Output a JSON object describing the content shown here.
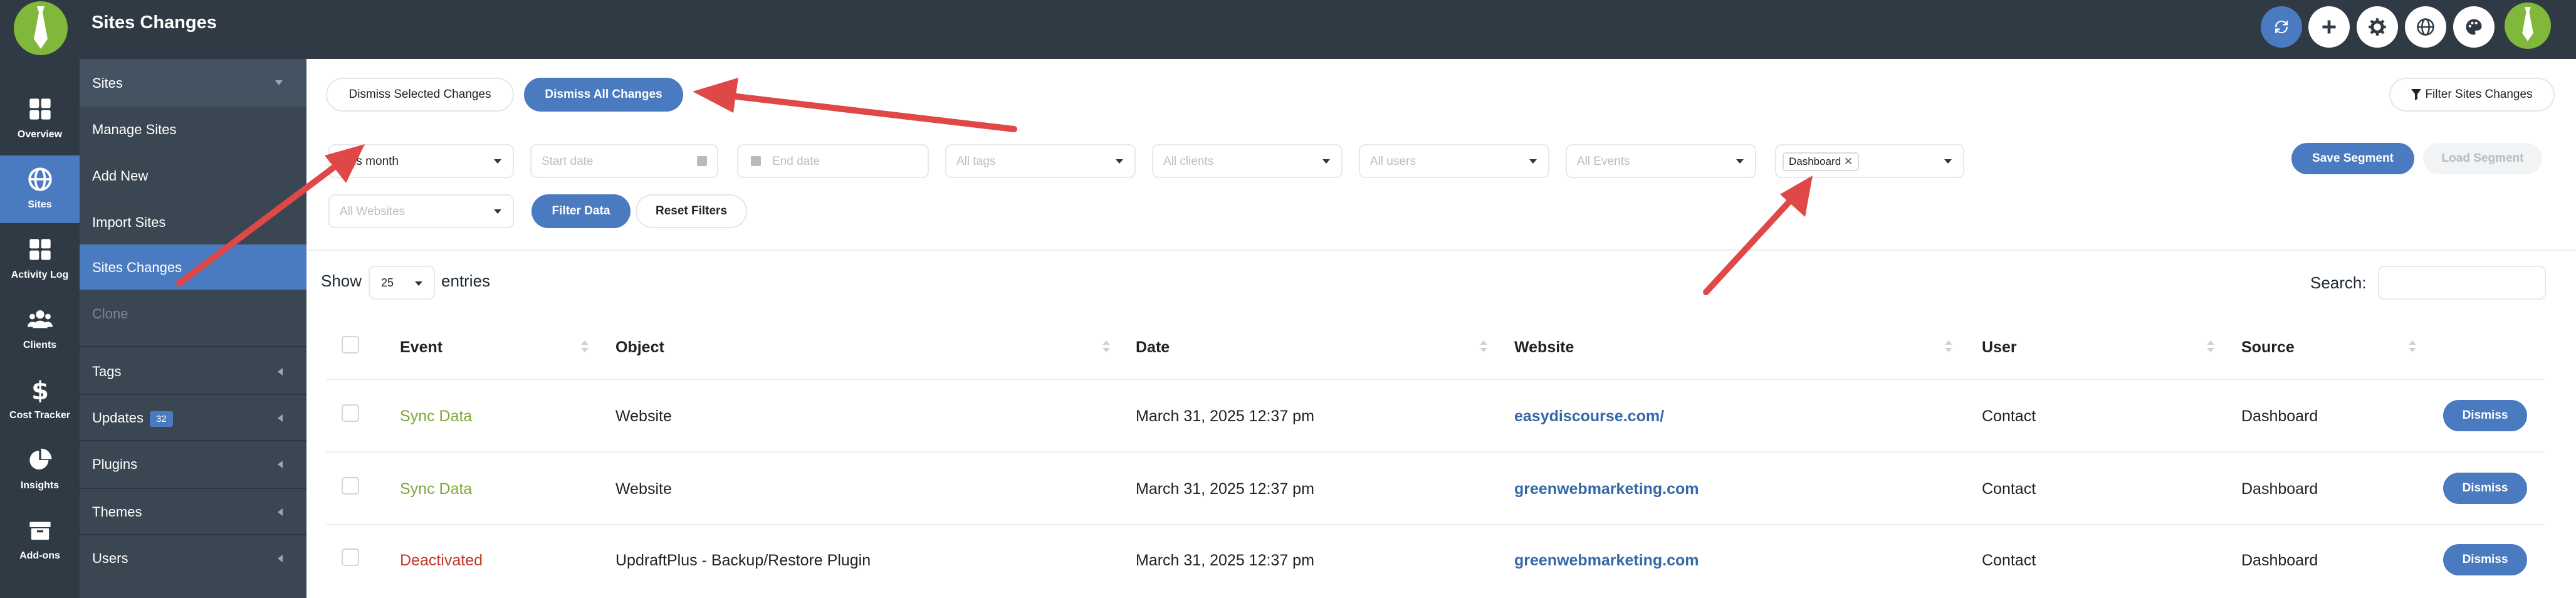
{
  "header": {
    "title": "Sites Changes"
  },
  "leftnav": [
    {
      "label": "Overview",
      "icon": "grid-icon"
    },
    {
      "label": "Sites",
      "icon": "globe-icon",
      "active": true
    },
    {
      "label": "Activity Log",
      "icon": "grid-icon"
    },
    {
      "label": "Clients",
      "icon": "users-icon"
    },
    {
      "label": "Cost Tracker",
      "icon": "dollar-icon"
    },
    {
      "label": "Insights",
      "icon": "pie-icon"
    },
    {
      "label": "Add-ons",
      "icon": "box-icon"
    }
  ],
  "submenu": {
    "head": "Sites",
    "items": [
      "Manage Sites",
      "Add New",
      "Import Sites",
      "Sites Changes",
      "Clone"
    ],
    "sections": [
      "Tags",
      "Updates",
      "Plugins",
      "Themes",
      "Users"
    ],
    "updates_badge": "32"
  },
  "toolbar": {
    "dismiss_selected": "Dismiss Selected Changes",
    "dismiss_all": "Dismiss All Changes",
    "filter_sites_changes": "Filter Sites Changes"
  },
  "filters": {
    "date_range": "This month",
    "start_date": "Start date",
    "end_date": "End date",
    "tags": "All tags",
    "clients": "All clients",
    "users": "All users",
    "events": "All Events",
    "source_tag": "Dashboard",
    "websites": "All Websites",
    "filter_data": "Filter Data",
    "reset_filters": "Reset Filters",
    "save_segment": "Save Segment",
    "load_segment": "Load Segment"
  },
  "table_controls": {
    "show": "Show",
    "entries_value": "25",
    "entries": "entries",
    "search_label": "Search:"
  },
  "table": {
    "columns": [
      "Event",
      "Object",
      "Date",
      "Website",
      "User",
      "Source"
    ],
    "rows": [
      {
        "event": "Sync Data",
        "event_status": "green",
        "object": "Website",
        "date": "March 31, 2025 12:37 pm",
        "website": "easydiscourse.com/",
        "user": "Contact",
        "source": "Dashboard",
        "action": "Dismiss"
      },
      {
        "event": "Sync Data",
        "event_status": "green",
        "object": "Website",
        "date": "March 31, 2025 12:37 pm",
        "website": "greenwebmarketing.com",
        "user": "Contact",
        "source": "Dashboard",
        "action": "Dismiss"
      },
      {
        "event": "Deactivated",
        "event_status": "red",
        "object": "UpdraftPlus - Backup/Restore Plugin",
        "date": "March 31, 2025 12:37 pm",
        "website": "greenwebmarketing.com",
        "user": "Contact",
        "source": "Dashboard",
        "action": "Dismiss"
      }
    ]
  },
  "colors": {
    "primary": "#4a7ac0",
    "brand_green": "#7fb83b",
    "annotation_red": "#e04848",
    "sidebar_dark": "#2f3a44"
  }
}
